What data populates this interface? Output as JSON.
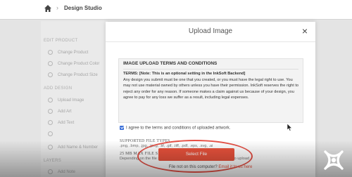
{
  "breadcrumb": {
    "separator": "›",
    "title": "Design Studio"
  },
  "sidebar": {
    "section1": "Edit Product",
    "items1": [
      "Change Product",
      "Change Product Color",
      "Change Product Size"
    ],
    "section2": "Add Design",
    "items2": [
      "Upload Image",
      "Add Art",
      "Add Text",
      "",
      "Add Name & Number"
    ],
    "section3": "Layers",
    "items3": [
      "Add Note"
    ]
  },
  "modal": {
    "title": "Upload Image",
    "close": "×",
    "terms_heading": "IMAGE UPLOAD TERMS AND CONDITIONS",
    "terms_bold": "TERMS: [Note: This is an optional setting in the InkSoft Backend]",
    "terms_body": "Any design you submit must be one that you created, or you must have the legal right to use. You may not use material owned by others unless you have their permission. InkSoft reserves the right to reject any order for any reason. If someone makes a claim against us because of your design, you agree to pay for any loss we suffer as a result, including legal expenses.",
    "agree_text": "I agree to the terms and conditions of uploaded artwork.",
    "supported_label": "SUPPORTED FILE TYPES",
    "supported_value": ".png, .bmp, .jpg, .jpeg, .tif, .gif, .tiff, .pdf, .eps, .svg, .ai",
    "max_label": "25 MB MAX FILE SIZE",
    "max_value": "Depending on the file size some images may take a few minutes to upload",
    "select_button": "Select File",
    "not_on_computer": "File not on this computer?",
    "email_link": "Email it to us here"
  },
  "colors": {
    "accent": "#e9523c",
    "checkbox": "#3a6fd8",
    "annotation": "#e65045"
  }
}
